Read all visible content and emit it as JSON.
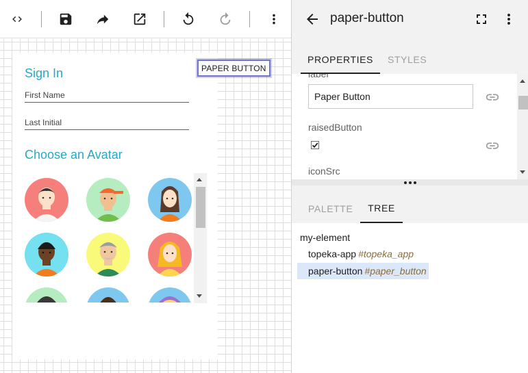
{
  "toolbar": {
    "buttons": [
      {
        "name": "code-view",
        "icon": "code-icon"
      },
      {
        "name": "save",
        "icon": "save-icon"
      },
      {
        "name": "share",
        "icon": "share-icon"
      },
      {
        "name": "open-external",
        "icon": "open-in-new-icon"
      },
      {
        "name": "undo",
        "icon": "undo-icon"
      },
      {
        "name": "redo",
        "icon": "redo-icon"
      },
      {
        "name": "more",
        "icon": "more-vert-icon"
      }
    ]
  },
  "canvas": {
    "sign_in_title": "Sign In",
    "first_name_label": "First Name",
    "last_initial_label": "Last Initial",
    "avatar_title": "Choose an Avatar",
    "selected_element_label": "PAPER BUTTON",
    "avatar_backgrounds": [
      "#f57f7a",
      "#b5edc0",
      "#7ec8f0",
      "#74e0f0",
      "#f9f97a",
      "#f57f7a",
      "#b5edc0",
      "#7ec8f0",
      "#7ec8f0"
    ]
  },
  "inspector": {
    "title": "paper-button",
    "tabs": {
      "properties": "PROPERTIES",
      "styles": "STYLES"
    },
    "properties": {
      "label_name": "label",
      "label_value": "Paper Button",
      "raised_name": "raisedButton",
      "raised_checked": true,
      "icon_src_name": "iconSrc"
    },
    "bottom_tabs": {
      "palette": "PALETTE",
      "tree": "TREE"
    },
    "tree": {
      "root": "my-element",
      "children": [
        {
          "tag": "topeka-app",
          "id": "#topeka_app"
        },
        {
          "tag": "paper-button",
          "id": "#paper_button",
          "selected": true
        }
      ]
    }
  },
  "colors": {
    "accent_title": "#26a9c8",
    "selection_outline": "#6f74c9",
    "tree_selected_bg": "#dbe8f9",
    "tree_id_text": "#8a6d3b"
  }
}
